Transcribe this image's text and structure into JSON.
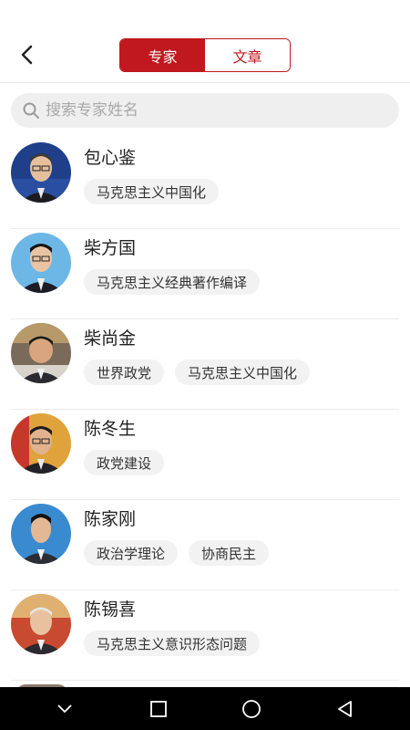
{
  "header": {
    "tabs": [
      {
        "label": "专家",
        "active": true
      },
      {
        "label": "文章",
        "active": false
      }
    ]
  },
  "search": {
    "placeholder": "搜索专家姓名",
    "value": ""
  },
  "experts": [
    {
      "name": "包心鉴",
      "tags": [
        "马克思主义中国化"
      ]
    },
    {
      "name": "柴方国",
      "tags": [
        "马克思主义经典著作编译"
      ]
    },
    {
      "name": "柴尚金",
      "tags": [
        "世界政党",
        "马克思主义中国化"
      ]
    },
    {
      "name": "陈冬生",
      "tags": [
        "政党建设"
      ]
    },
    {
      "name": "陈家刚",
      "tags": [
        "政治学理论",
        "协商民主"
      ]
    },
    {
      "name": "陈锡喜",
      "tags": [
        "马克思主义意识形态问题"
      ]
    }
  ],
  "colors": {
    "accent": "#c0181e",
    "tag_bg": "#f2f2f2",
    "search_bg": "#efefef"
  },
  "navbar": {
    "icons": [
      "chevron-down-icon",
      "square-icon",
      "circle-icon",
      "triangle-back-icon"
    ]
  }
}
